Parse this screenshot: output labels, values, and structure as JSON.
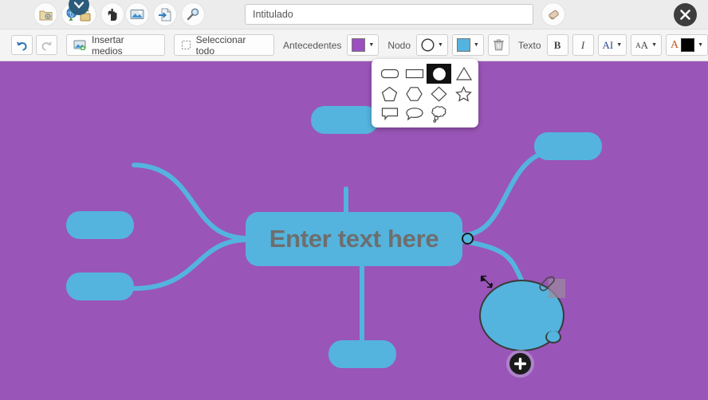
{
  "window": {
    "title_value": "Intitulado",
    "title_placeholder": "Intitulado",
    "close_label": "✖"
  },
  "topbar": {
    "buttons": [
      {
        "name": "folder-settings-icon",
        "tooltip": "Archivo"
      },
      {
        "name": "globe-unlock-icon",
        "tooltip": "Publicar"
      },
      {
        "name": "hand-pointer-icon",
        "tooltip": "Herramienta"
      },
      {
        "name": "image-icon",
        "tooltip": "Imagen"
      },
      {
        "name": "import-file-icon",
        "tooltip": "Importar"
      },
      {
        "name": "magnifier-icon",
        "tooltip": "Buscar"
      },
      {
        "name": "eraser-icon",
        "tooltip": "Borrador"
      }
    ],
    "badge_glyph": "❯"
  },
  "toolbar": {
    "undo_glyph": "↺",
    "redo_glyph": "↻",
    "insert_media_label": "Insertar medios",
    "select_all_label": "Seleccionar todo",
    "background_label": "Antecedentes",
    "background_color": "#9b4fc0",
    "node_label": "Nodo",
    "node_color": "#54b4dd",
    "trash_glyph": "🗑",
    "text_label": "Texto",
    "bold_label": "B",
    "italic_label": "I",
    "font_family_label": "AI",
    "font_size_label": "A",
    "font_size_sub": "A",
    "text_color_label": "A",
    "text_color": "#000000",
    "caret_glyph": "▼"
  },
  "shape_menu": {
    "selected_index": 2,
    "shapes": [
      {
        "name": "rounded-rectangle-shape"
      },
      {
        "name": "rectangle-shape"
      },
      {
        "name": "circle-shape"
      },
      {
        "name": "triangle-shape"
      },
      {
        "name": "pentagon-shape"
      },
      {
        "name": "hexagon-shape"
      },
      {
        "name": "diamond-shape"
      },
      {
        "name": "star-shape"
      },
      {
        "name": "speech-bubble-rect-shape"
      },
      {
        "name": "speech-bubble-oval-shape"
      },
      {
        "name": "thought-bubble-shape"
      }
    ]
  },
  "canvas": {
    "background_color": "#9a55b8",
    "node_color": "#54b4dd",
    "center_node_text": "Enter text here",
    "center_node_text_color": "#6e6e6e",
    "plus_glyph": "➕",
    "resize_glyph": "↖",
    "clip_glyph": "📎",
    "child_nodes": [
      {
        "name": "node-top",
        "label": ""
      },
      {
        "name": "node-upper-left",
        "label": ""
      },
      {
        "name": "node-lower-left",
        "label": ""
      },
      {
        "name": "node-right",
        "label": ""
      },
      {
        "name": "node-bottom",
        "label": ""
      },
      {
        "name": "node-selected-circle",
        "label": ""
      }
    ]
  }
}
